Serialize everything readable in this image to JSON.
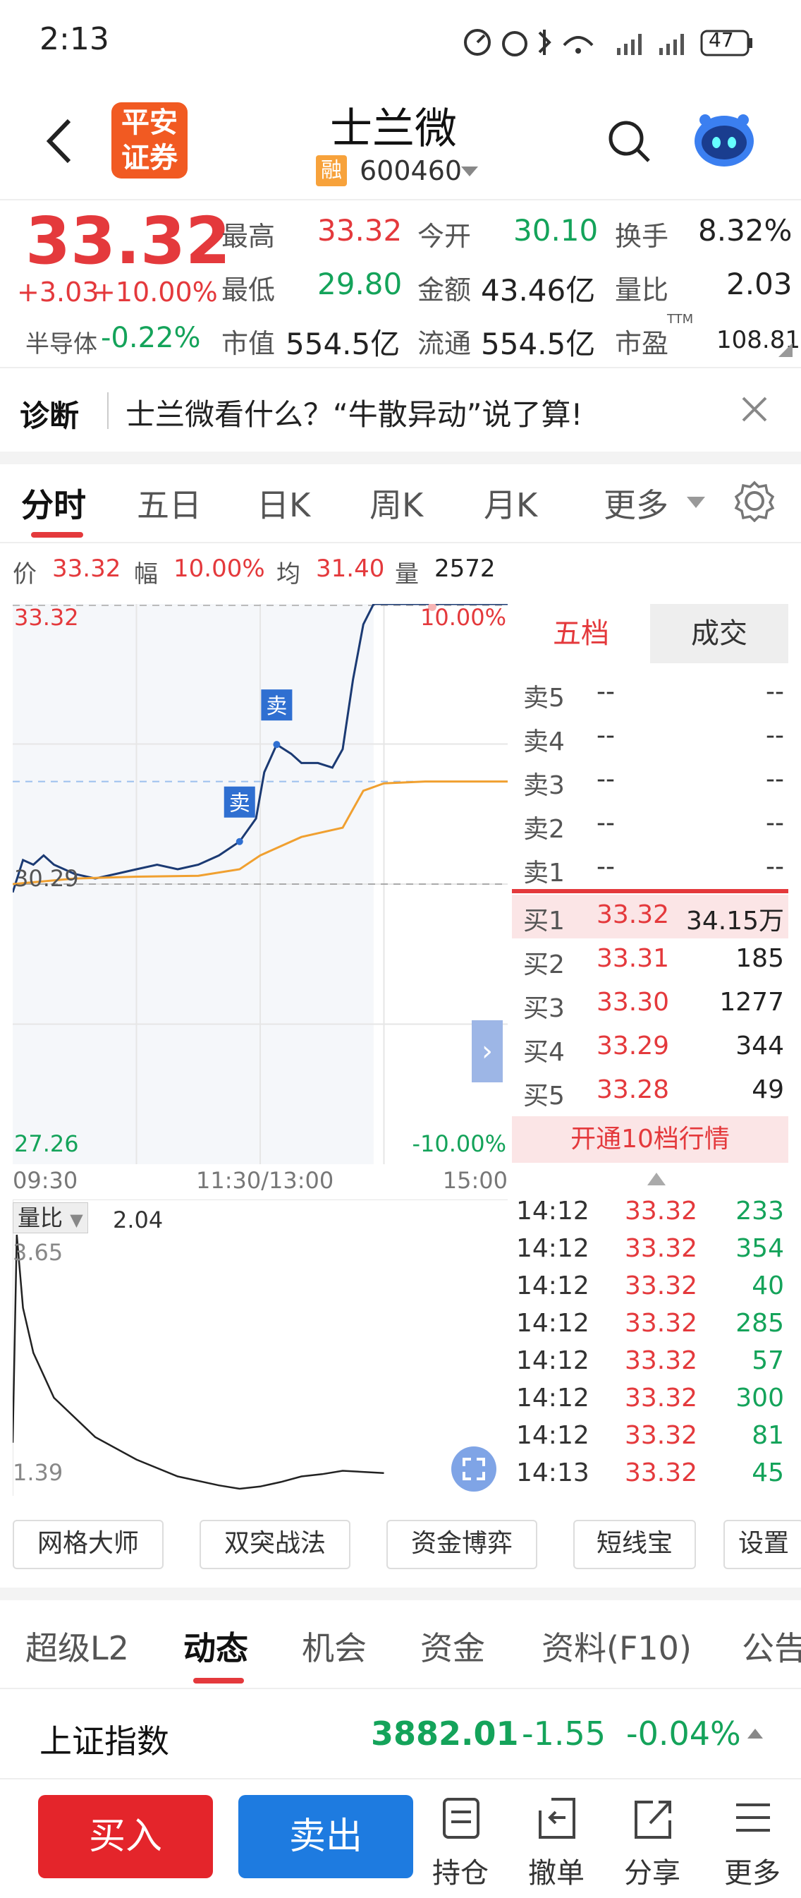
{
  "statusbar": {
    "time": "2:13",
    "battery": "47"
  },
  "header": {
    "title": "士兰微",
    "code": "600460",
    "rong_badge": "融",
    "logo_text": "平安证券"
  },
  "quote": {
    "price": "33.32",
    "change": "+3.03",
    "change_pct": "+10.00%",
    "sector_name": "半导体",
    "sector_change": "-0.22%",
    "labels": {
      "high": "最高",
      "low": "最低",
      "mktcap": "市值",
      "open": "今开",
      "amount": "金额",
      "float": "流通",
      "turnover": "换手",
      "volratio": "量比",
      "pe": "市盈",
      "ttm": "TTM"
    },
    "high": "33.32",
    "low": "29.80",
    "mktcap": "554.5亿",
    "open": "30.10",
    "amount": "43.46亿",
    "float": "554.5亿",
    "turnover": "8.32%",
    "volratio": "2.03",
    "pe": "108.81"
  },
  "diagnosis": {
    "label": "诊断",
    "text": "士兰微看什么？“牛散异动”说了算!"
  },
  "chart_tabs": [
    "分时",
    "五日",
    "日K",
    "周K",
    "月K",
    "更多"
  ],
  "info_line": {
    "price_label": "价",
    "price": "33.32",
    "range_label": "幅",
    "range": "10.00%",
    "avg_label": "均",
    "avg": "31.40",
    "vol_label": "量",
    "vol": "2572"
  },
  "chart_labels": {
    "top_left": "33.32",
    "top_right": "10.00%",
    "mid_left": "30.29",
    "bottom_left": "27.26",
    "bottom_right": "-10.00%",
    "time_start": "09:30",
    "time_mid": "11:30/13:00",
    "time_end": "15:00",
    "sell_mark": "卖"
  },
  "chart_data": {
    "type": "line",
    "x_range": [
      "09:30",
      "15:00"
    ],
    "ylim": [
      27.26,
      33.32
    ],
    "yticks": [
      "33.32",
      "30.29",
      "27.26"
    ],
    "right_ticks": [
      "10.00%",
      "-10.00%"
    ],
    "xticks": [
      "09:30",
      "11:30/13:00",
      "15:00"
    ],
    "series": [
      {
        "x": [
          0,
          5,
          10,
          15,
          20,
          25,
          30,
          40,
          50,
          60,
          70,
          80,
          90,
          100,
          110,
          118,
          122,
          128,
          135,
          140,
          148,
          155,
          160,
          165,
          170,
          175,
          185,
          200,
          240
        ],
        "values": [
          30.2,
          30.55,
          30.5,
          30.6,
          30.5,
          30.45,
          30.4,
          30.35,
          30.4,
          30.45,
          30.5,
          30.45,
          30.5,
          30.6,
          30.75,
          31.0,
          31.5,
          31.8,
          31.7,
          31.6,
          31.6,
          31.55,
          31.75,
          32.5,
          33.1,
          33.32,
          33.32,
          33.32,
          33.32
        ]
      },
      {
        "x": [
          0,
          30,
          60,
          90,
          110,
          120,
          140,
          160,
          165,
          170,
          180,
          200,
          240
        ],
        "values": [
          30.29,
          30.35,
          30.37,
          30.38,
          30.45,
          30.6,
          30.8,
          30.9,
          31.1,
          31.3,
          31.38,
          31.4,
          31.4
        ]
      }
    ],
    "markers": [
      {
        "x": 110,
        "label": "卖"
      },
      {
        "x": 128,
        "label": "卖"
      }
    ]
  },
  "vol_chart": {
    "label": "量比",
    "value": "2.04",
    "top": "3.65",
    "bottom": "1.39"
  },
  "vol_chart_data": {
    "type": "line",
    "ylim": [
      1.39,
      3.65
    ],
    "x": [
      0,
      2,
      5,
      10,
      20,
      40,
      60,
      80,
      100,
      110,
      120,
      130,
      140,
      150,
      160,
      180
    ],
    "values": [
      1.8,
      3.65,
      3.0,
      2.6,
      2.2,
      1.85,
      1.65,
      1.5,
      1.42,
      1.39,
      1.41,
      1.45,
      1.5,
      1.52,
      1.55,
      1.53
    ]
  },
  "orderbook": {
    "tabs": [
      "五档",
      "成交"
    ],
    "asks": [
      {
        "label": "卖5",
        "price": "--",
        "vol": "--"
      },
      {
        "label": "卖4",
        "price": "--",
        "vol": "--"
      },
      {
        "label": "卖3",
        "price": "--",
        "vol": "--"
      },
      {
        "label": "卖2",
        "price": "--",
        "vol": "--"
      },
      {
        "label": "卖1",
        "price": "--",
        "vol": "--"
      }
    ],
    "bids": [
      {
        "label": "买1",
        "price": "33.32",
        "vol": "34.15万"
      },
      {
        "label": "买2",
        "price": "33.31",
        "vol": "185"
      },
      {
        "label": "买3",
        "price": "33.30",
        "vol": "1277"
      },
      {
        "label": "买4",
        "price": "33.29",
        "vol": "344"
      },
      {
        "label": "买5",
        "price": "33.28",
        "vol": "49"
      }
    ],
    "open10": "开通10档行情"
  },
  "trades": [
    {
      "time": "14:12",
      "price": "33.32",
      "vol": "233"
    },
    {
      "time": "14:12",
      "price": "33.32",
      "vol": "354"
    },
    {
      "time": "14:12",
      "price": "33.32",
      "vol": "40"
    },
    {
      "time": "14:12",
      "price": "33.32",
      "vol": "285"
    },
    {
      "time": "14:12",
      "price": "33.32",
      "vol": "57"
    },
    {
      "time": "14:12",
      "price": "33.32",
      "vol": "300"
    },
    {
      "time": "14:12",
      "price": "33.32",
      "vol": "81"
    },
    {
      "time": "14:13",
      "price": "33.32",
      "vol": "45"
    }
  ],
  "tools": [
    "网格大师",
    "双突战法",
    "资金博弈",
    "短线宝",
    "设置"
  ],
  "nav_tabs": [
    "超级L2",
    "动态",
    "机会",
    "资金",
    "资料(F10)",
    "公告"
  ],
  "index_bar": {
    "name": "上证指数",
    "value": "3882.01",
    "change": "-1.55",
    "pct": "-0.04%"
  },
  "bottom": {
    "buy": "买入",
    "sell": "卖出",
    "hold": "持仓",
    "cancel": "撤单",
    "share": "分享",
    "more": "更多"
  }
}
